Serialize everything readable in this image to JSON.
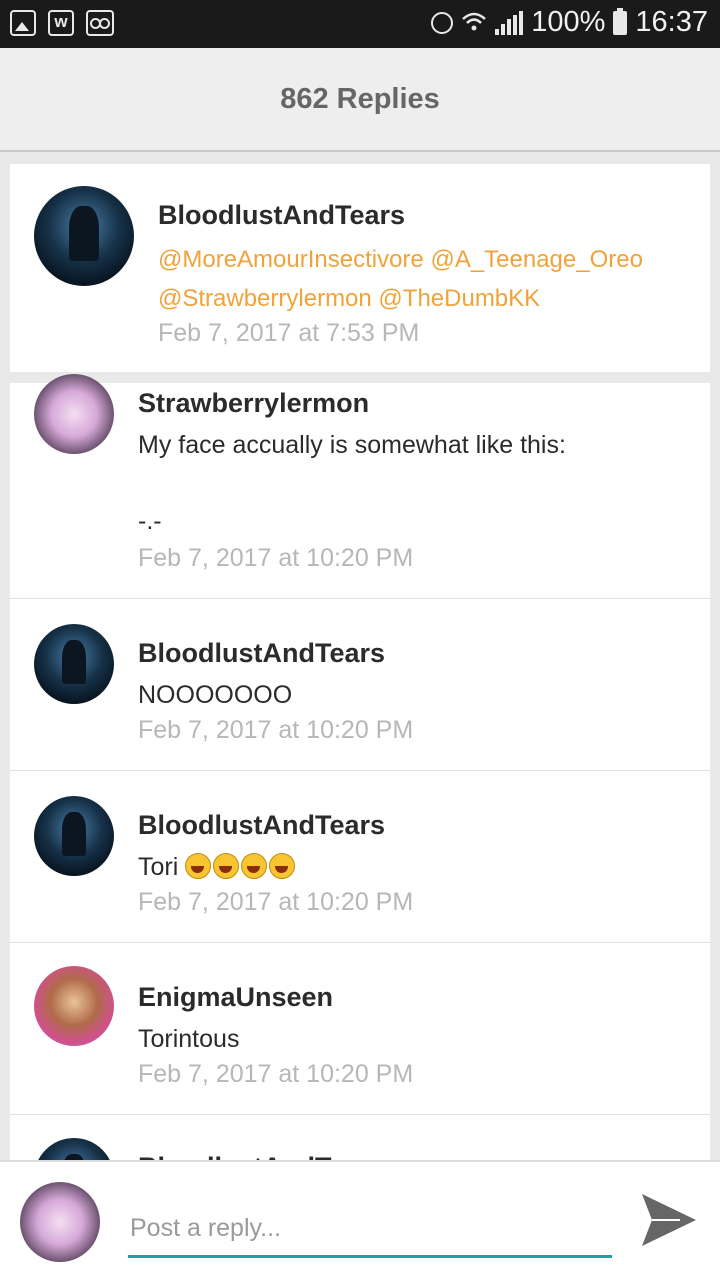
{
  "status_bar": {
    "battery": "100%",
    "time": "16:37"
  },
  "header": {
    "title": "862 Replies"
  },
  "post": {
    "author": "BloodlustAndTears",
    "mentions_line1": "@MoreAmourInsectivore @A_Teenage_Oreo",
    "mentions_line2": "@Strawberrylermon @TheDumbKK",
    "time": "Feb 7, 2017 at 7:53 PM"
  },
  "replies": [
    {
      "author": "Strawberrylermon",
      "message": "My face accually is somewhat like this:\n\n-.-",
      "time": "Feb 7, 2017 at 10:20 PM"
    },
    {
      "author": "BloodlustAndTears",
      "message": "NOOOOOOO",
      "time": "Feb 7, 2017 at 10:20 PM"
    },
    {
      "author": "BloodlustAndTears",
      "message": "Tori",
      "time": "Feb 7, 2017 at 10:20 PM"
    },
    {
      "author": "EnigmaUnseen",
      "message": "Torintous",
      "time": "Feb 7, 2017 at 10:20 PM"
    },
    {
      "author": "BloodlustAndTears"
    }
  ],
  "reply_bar": {
    "placeholder": "Post a reply..."
  },
  "colors": {
    "mention": "#f1a33a",
    "accent": "#1aa3a0"
  }
}
